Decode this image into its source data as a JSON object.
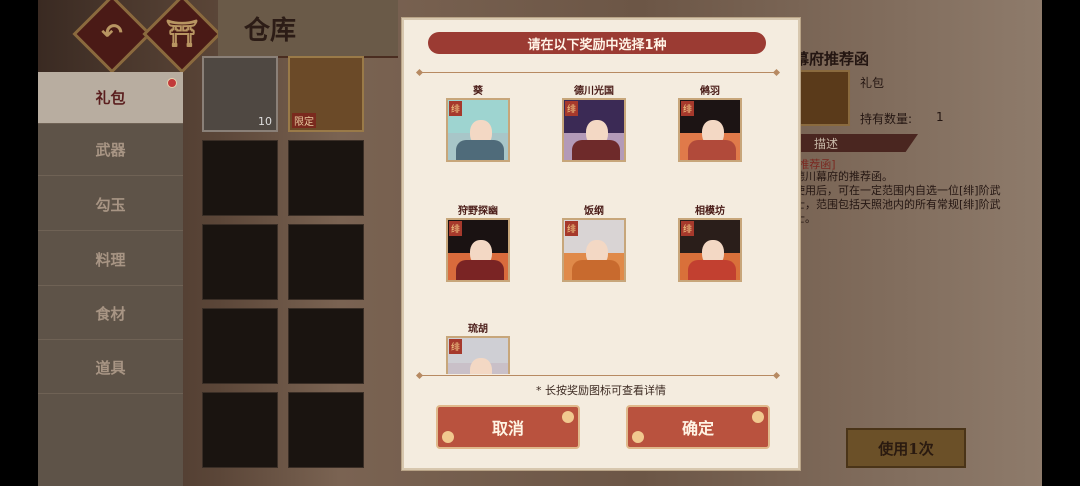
{
  "header": {
    "title": "仓库",
    "back_icon": "back-arrow-icon",
    "home_icon": "torii-icon"
  },
  "sidebar": {
    "items": [
      {
        "label": "礼包",
        "active": true
      },
      {
        "label": "武器"
      },
      {
        "label": "勾玉"
      },
      {
        "label": "料理"
      },
      {
        "label": "食材"
      },
      {
        "label": "道具"
      }
    ]
  },
  "inventory": {
    "slot1_count": "10",
    "slot2_tag": "限定"
  },
  "info": {
    "name": "幕府推荐函",
    "type": "礼包",
    "count_label": "持有数量:",
    "count_value": "1",
    "desc_label": "描述",
    "desc_head": "[推荐函]",
    "desc_body": "德川幕府的推荐函。\n使用后，可在一定范围内自选一位[绯]阶武士，范围包括天照池内的所有常规[绯]阶武士。",
    "use_button": "使用1次"
  },
  "modal": {
    "title": "请在以下奖励中选择1种",
    "characters": [
      {
        "name": "葵",
        "hair": "#9ed4d0",
        "body": "#4f6b7a",
        "badge": "绯"
      },
      {
        "name": "德川光国",
        "hair": "#3b2a55",
        "body": "#6e2a2a",
        "badge": "绯"
      },
      {
        "name": "鸺羽",
        "hair": "#1c1414",
        "body": "#b14a3a",
        "badge": "绯"
      },
      {
        "name": "狩野探幽",
        "hair": "#1a1212",
        "body": "#7a2424",
        "badge": "绯"
      },
      {
        "name": "饭纲",
        "hair": "#d9d4d4",
        "body": "#c86a2e",
        "badge": "绯"
      },
      {
        "name": "相模坊",
        "hair": "#2a1e1a",
        "body": "#c24030",
        "badge": "绯"
      },
      {
        "name": "琉胡",
        "hair": "#cfcfd4",
        "body": "#e0dde0",
        "badge": "绯"
      }
    ],
    "hint": "* 长按奖励图标可查看详情",
    "cancel_label": "取消",
    "confirm_label": "确定"
  }
}
